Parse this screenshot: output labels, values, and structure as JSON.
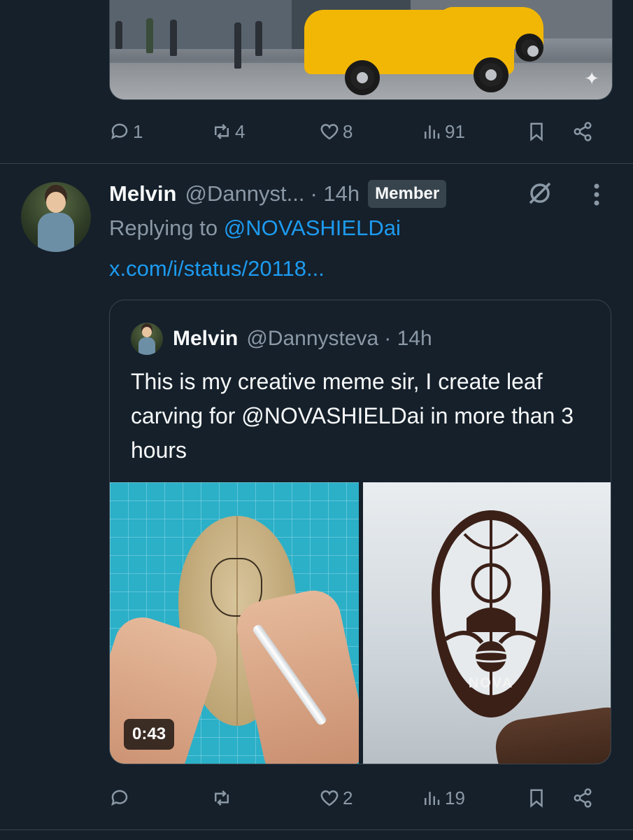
{
  "top_tweet": {
    "actions": {
      "replies": "1",
      "reposts": "4",
      "likes": "8",
      "views": "91"
    }
  },
  "reply_tweet": {
    "author": {
      "name": "Melvin",
      "handle": "@Dannyst...",
      "time": "· 14h",
      "badge": "Member"
    },
    "replying_prefix": "Replying to ",
    "replying_to": "@NOVASHIELDai",
    "link": "x.com/i/status/20118...",
    "quote": {
      "name": "Melvin",
      "handle": "@Dannysteva",
      "time": "· 14h",
      "text": "This is my creative meme sir, I create leaf carving for @NOVASHIELDai in more than 3 hours",
      "video_duration": "0:43",
      "carving_label": "NOVA"
    },
    "actions": {
      "replies": "",
      "reposts": "",
      "likes": "2",
      "views": "19"
    }
  },
  "colors": {
    "background": "#15202b",
    "border": "#38444d",
    "muted": "#8b98a5",
    "link": "#1d9bf0",
    "text": "#f7f9f9"
  },
  "icons": [
    "reply-icon",
    "repost-icon",
    "like-icon",
    "views-icon",
    "bookmark-icon",
    "share-icon",
    "grok-icon",
    "more-icon",
    "sparkle-icon"
  ]
}
